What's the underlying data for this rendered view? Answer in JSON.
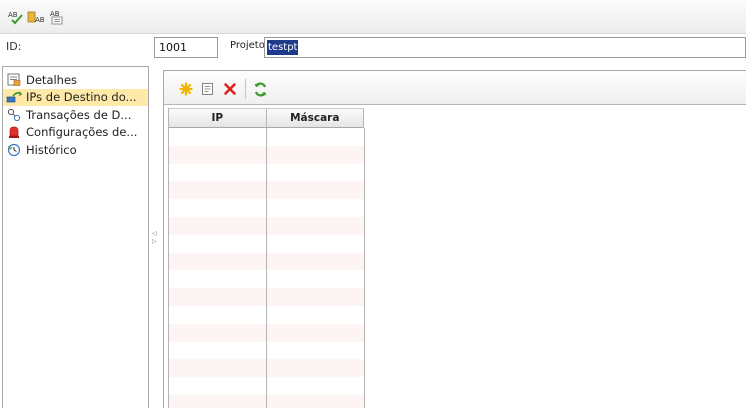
{
  "top_toolbar": {
    "icons": [
      "spell-check-icon",
      "spell-check-field-icon",
      "spell-check-options-icon"
    ]
  },
  "form": {
    "id_label": "ID:",
    "id_value": "1001",
    "project_label": "Projeto:",
    "project_value": "testpt"
  },
  "nav": {
    "items": [
      {
        "label": "Detalhes",
        "icon": "details-icon",
        "selected": false
      },
      {
        "label": "IPs de Destino do...",
        "icon": "network-ip-icon",
        "selected": true
      },
      {
        "label": "Transações de D...",
        "icon": "transactions-icon",
        "selected": false
      },
      {
        "label": "Configurações de...",
        "icon": "alert-settings-icon",
        "selected": false
      },
      {
        "label": "Histórico",
        "icon": "history-icon",
        "selected": false
      }
    ]
  },
  "panel_toolbar": {
    "buttons": [
      "new-icon",
      "edit-icon",
      "delete-icon",
      "refresh-icon"
    ]
  },
  "grid": {
    "columns": [
      "IP",
      "Máscara"
    ],
    "rows": []
  },
  "colors": {
    "selected_nav": "#ffe9a8",
    "selection_highlight": "#1e3a8a",
    "delete_red": "#d9251c",
    "new_yellow": "#f0b400",
    "refresh_green": "#3b9b2e"
  }
}
